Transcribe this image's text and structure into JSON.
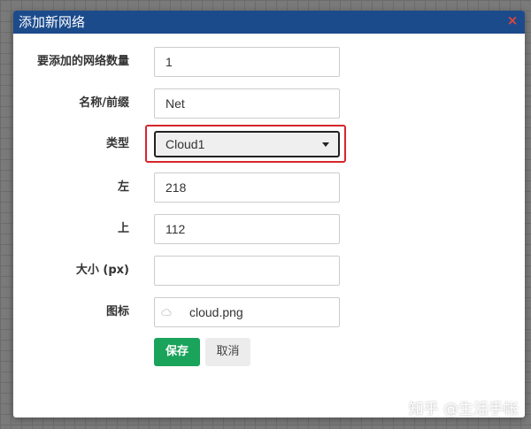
{
  "dialog": {
    "title": "添加新网络",
    "close_glyph": "×"
  },
  "form": {
    "count": {
      "label": "要添加的网络数量",
      "value": "1"
    },
    "name_prefix": {
      "label": "名称/前缀",
      "value": "Net"
    },
    "type": {
      "label": "类型",
      "selected": "Cloud1"
    },
    "left": {
      "label": "左",
      "value": "218"
    },
    "top": {
      "label": "上",
      "value": "112"
    },
    "size": {
      "label": "大小 (px)",
      "value": ""
    },
    "icon": {
      "label": "图标",
      "file": "cloud.png",
      "icon_name": "cloud-icon"
    }
  },
  "buttons": {
    "save": "保存",
    "cancel": "取消"
  },
  "watermark": "知乎 @生活手帐",
  "colors": {
    "titlebar": "#1c4b8c",
    "save_button": "#1aa35a",
    "highlight_border": "#d7262b",
    "close_icon": "#e0463a"
  }
}
